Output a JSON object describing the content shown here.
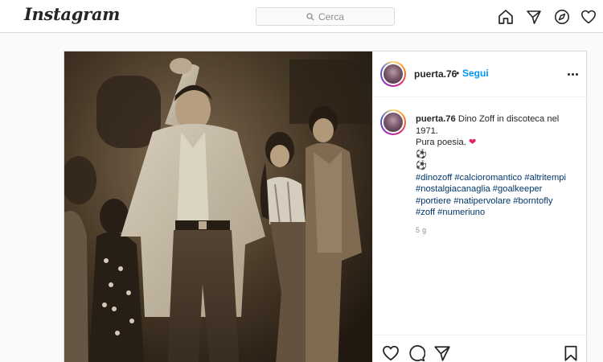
{
  "header": {
    "logo": "Instagram",
    "search_placeholder": "Cerca",
    "icons": [
      "home-icon",
      "direct-icon",
      "explore-icon",
      "activity-icon"
    ]
  },
  "post": {
    "username": "puerta.76",
    "dot": "•",
    "follow_label": "Segui",
    "caption_user": "puerta.76",
    "caption_text": "Dino Zoff in discoteca nel 1971.",
    "caption_line2": "Pura poesia.",
    "caption_heart": "❤",
    "caption_ball1": "⚽",
    "caption_ball2": "⚽",
    "hashtags": [
      "#dinozoff",
      "#calcioromantico",
      "#altritempi",
      "#nostalgiacanaglia",
      "#goalkeeper",
      "#portiere",
      "#natipervolare",
      "#borntofly",
      "#zoff",
      "#numeriuno"
    ],
    "time": "5 g",
    "photo_description": "sepia",
    "icons": [
      "like-icon",
      "comment-icon",
      "share-icon",
      "save-icon",
      "more-options-icon"
    ]
  }
}
